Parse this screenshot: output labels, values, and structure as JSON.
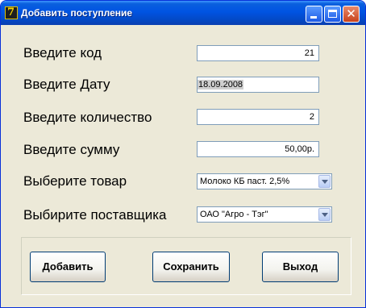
{
  "window": {
    "title": "Добавить поступление",
    "icon_glyph": "7"
  },
  "form": {
    "code_label": "Введите код",
    "code_value": "21",
    "date_label": "Введите Дату",
    "date_value": "18.09.2008",
    "qty_label": "Введите количество",
    "qty_value": "2",
    "sum_label": "Введите сумму",
    "sum_value": "50,00р.",
    "product_label": "Выберите товар",
    "product_value": "Молоко КБ паст. 2,5%",
    "supplier_label": "Выбирите поставщика",
    "supplier_value": "ОАО \"Агро - Тэг\""
  },
  "buttons": {
    "add": "Добавить",
    "save": "Сохранить",
    "exit": "Выход"
  },
  "colors": {
    "titlebar": "#0054e3",
    "window_bg": "#ece9d8",
    "close_button": "#c8421c",
    "button_border": "#003c74"
  }
}
